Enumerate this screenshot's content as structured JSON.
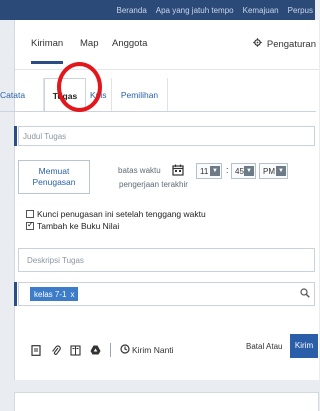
{
  "topnav": {
    "items": [
      "Beranda",
      "Apa yang jatuh tempo",
      "Kemajuan",
      "Perpus"
    ]
  },
  "post_tabs": {
    "post": "Kiriman",
    "folder": "Map",
    "members": "Anggota",
    "settings": "Pengaturan"
  },
  "compose_tabs": {
    "note": "Catata",
    "assignment": "Tugas",
    "quiz": "Kuis",
    "poll": "Pemilihan"
  },
  "assignment": {
    "title_placeholder": "Judul Tugas",
    "load_button": "Memuat Penugasan",
    "deadline_label": "batas waktu",
    "deadline_sub": "pengerjaan terakhir",
    "hour": "11",
    "minute": "45",
    "ampm": "PM",
    "lock_after_due": "Kunci penugasan ini setelah tenggang waktu",
    "add_to_gradebook": "Tambah ke Buku Nilai",
    "description_placeholder": "Deskripsi Tugas",
    "recipient_tag": "kelas 7-1",
    "recipient_remove": "x"
  },
  "actions": {
    "schedule": "Kirim Nanti",
    "cancel": "Batal Atau",
    "post": "Kirim"
  },
  "colors": {
    "topbar": "#2c4a78",
    "accent": "#2a5ea8",
    "annotation": "#e3161b"
  }
}
